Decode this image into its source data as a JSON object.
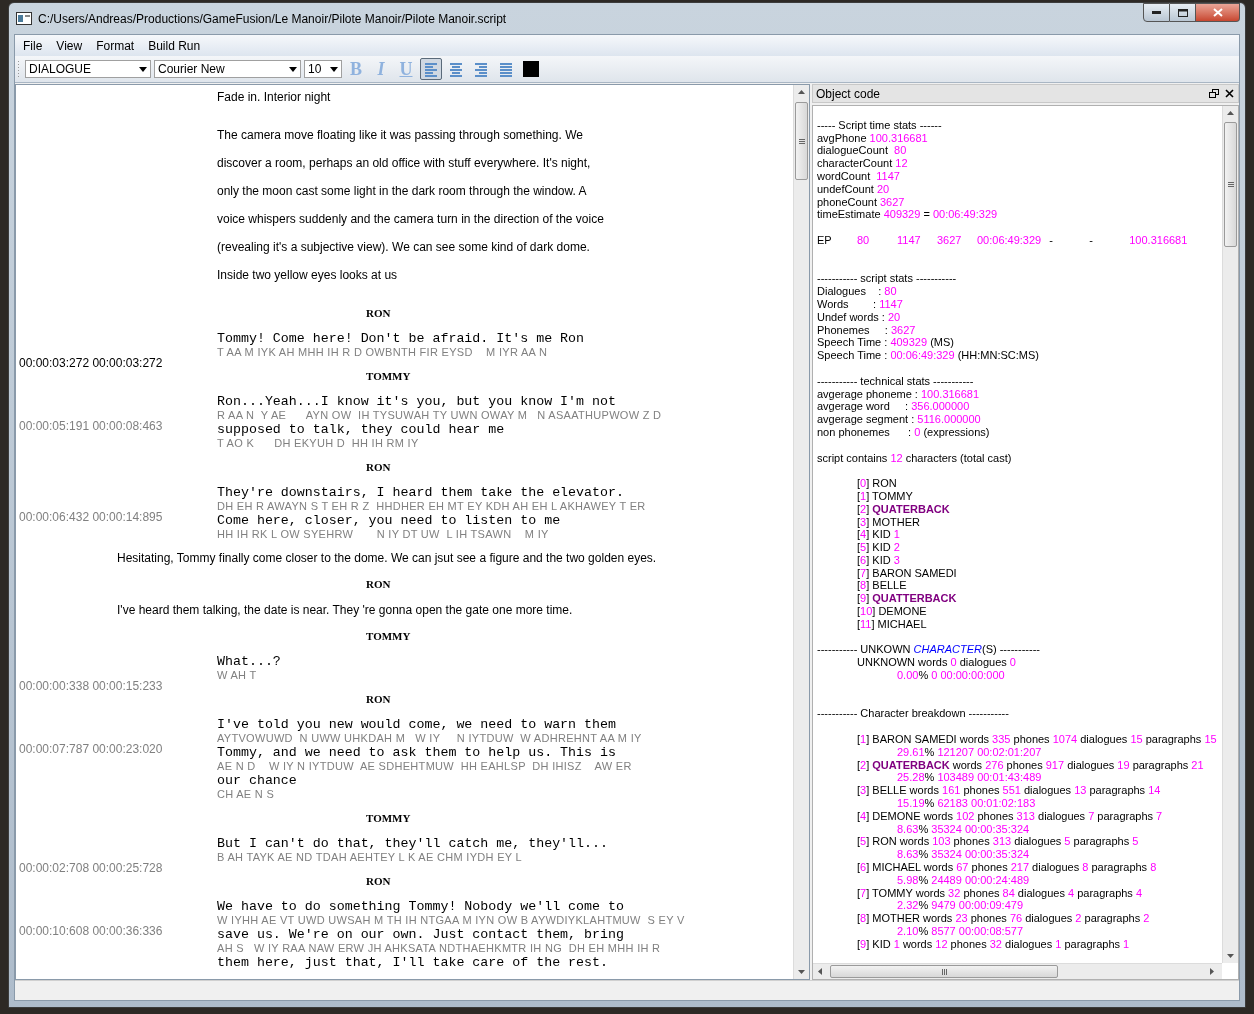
{
  "window": {
    "title": "C:/Users/Andreas/Productions/GameFusion/Le Manoir/Pilote Manoir/Pilote Manoir.script"
  },
  "menu": [
    "File",
    "View",
    "Format",
    "Build Run"
  ],
  "toolbar": {
    "style": "DIALOGUE",
    "font": "Courier New",
    "size": "10",
    "format_buttons": [
      {
        "label": "B",
        "kind": "bold"
      },
      {
        "label": "I",
        "kind": "italic"
      },
      {
        "label": "U",
        "kind": "underline"
      }
    ],
    "align_buttons": [
      {
        "kind": "left",
        "selected": true
      },
      {
        "kind": "center",
        "selected": false
      },
      {
        "kind": "right",
        "selected": false
      },
      {
        "kind": "justify",
        "selected": false
      }
    ]
  },
  "script": [
    {
      "kind": "action",
      "lines": [
        "Fade in. Interior night"
      ]
    },
    {
      "kind": "action",
      "lines": [
        "The camera move floating like it was passing through something. We",
        "discover a room, perhaps an old office with stuff everywhere. It's night,",
        "only the moon cast some light in the dark room through the window. A",
        "voice whispers suddenly and the camera turn in the direction of the voice",
        "(revealing it's a subjective view). We can see some kind of dark dome.",
        "Inside two yellow eyes looks at us"
      ]
    },
    {
      "kind": "character",
      "name": "RON"
    },
    {
      "kind": "dialogue",
      "timecode": "00:00:03:272 00:00:03:272",
      "current": true,
      "lines": [
        {
          "text": "Tommy! Come here! Don't be afraid. It's me Ron",
          "phonemes": "T AA M IYK AH MHH IH R D OWBNTH FIR EYSD    M IYR AA N"
        }
      ]
    },
    {
      "kind": "character",
      "name": "TOMMY"
    },
    {
      "kind": "dialogue",
      "timecode": "00:00:05:191 00:00:08:463",
      "current": false,
      "lines": [
        {
          "text": "Ron...Yeah...I know it's you, but you know I'm not",
          "phonemes": "R AA N  Y AE      AYN OW  IH TYSUWAH TY UWN OWAY M   N ASAATHUPWOW Z D"
        },
        {
          "text": "supposed to talk, they could hear me",
          "phonemes": "T AO K      DH EKYUH D  HH IH RM IY"
        }
      ]
    },
    {
      "kind": "character",
      "name": "RON"
    },
    {
      "kind": "dialogue",
      "timecode": "00:00:06:432 00:00:14:895",
      "current": false,
      "lines": [
        {
          "text": "They're downstairs, I heard them take the elevator.",
          "phonemes": "DH EH R AWAYN S T EH R Z  HHDHER EH MT EY KDH AH EH L AKHAWEY T ER"
        },
        {
          "text": "Come here, closer, you need to listen to me",
          "phonemes": "HH IH RK L OW SYEHRW       N IY DT UW  L IH TSAWN    M IY"
        }
      ]
    },
    {
      "kind": "scene",
      "lines": [
        "Hesitating, Tommy finally come closer to the dome. We can jsut see a figure and the two golden eyes."
      ]
    },
    {
      "kind": "character",
      "name": "RON"
    },
    {
      "kind": "scene",
      "lines": [
        "I've heard them talking, the date is near. They 're gonna open the gate one more time."
      ]
    },
    {
      "kind": "character",
      "name": "TOMMY"
    },
    {
      "kind": "dialogue",
      "timecode": "00:00:00:338 00:00:15:233",
      "current": false,
      "lines": [
        {
          "text": "What...?",
          "phonemes": "W AH T"
        }
      ]
    },
    {
      "kind": "character",
      "name": "RON"
    },
    {
      "kind": "dialogue",
      "timecode": "00:00:07:787 00:00:23:020",
      "current": false,
      "lines": [
        {
          "text": "I've told you new would come, we need to warn them",
          "phonemes": "AYTVOWUWD  N UWW UHKDAH M   W IY     N IYTDUW  W ADHREHNT AA M IY"
        },
        {
          "text": "Tommy, and we need to ask them to help us. This is",
          "phonemes": "AE N D    W IY N IYTDUW  AE SDHEHTMUW  HH EAHLSP  DH IHISZ    AW ER"
        },
        {
          "text": "our chance",
          "phonemes": "CH AE N S"
        }
      ]
    },
    {
      "kind": "character",
      "name": "TOMMY"
    },
    {
      "kind": "dialogue",
      "timecode": "00:00:02:708 00:00:25:728",
      "current": false,
      "lines": [
        {
          "text": "But I can't do that, they'll catch me, they'll...",
          "phonemes": "B AH TAYK AE ND TDAH AEHTEY L K AE CHM IYDH EY L"
        }
      ]
    },
    {
      "kind": "character",
      "name": "RON"
    },
    {
      "kind": "dialogue",
      "timecode": "00:00:10:608 00:00:36:336",
      "current": false,
      "lines": [
        {
          "text": "We have to do something Tommy! Nobody we'll come to",
          "phonemes": "W IYHH AE VT UWD UWSAH M TH IH NTGAA M IYN OW B AYWDIYKLAHTMUW  S EY V"
        },
        {
          "text": "save us. We're on our own. Just contact them, bring",
          "phonemes": "AH S   W IY RAA NAW ERW JH AHKSATA NDTHAEHKMTR IH NG  DH EH MHH IH R"
        },
        {
          "text": "them here, just that, I'll take care of the rest."
        }
      ]
    }
  ],
  "dock": {
    "title": "Object code",
    "lines": [
      {
        "kind": "blank"
      },
      {
        "kind": "text",
        "parts": [
          {
            "text": "----- Script time stats ------",
            "kind": "label"
          }
        ]
      },
      {
        "kind": "text",
        "parts": [
          {
            "text": "avgPhone ",
            "kind": "label"
          },
          {
            "text": "100.316681",
            "kind": "value"
          }
        ]
      },
      {
        "kind": "text",
        "parts": [
          {
            "text": "dialogueCount  ",
            "kind": "label"
          },
          {
            "text": "80",
            "kind": "value"
          }
        ]
      },
      {
        "kind": "text",
        "parts": [
          {
            "text": "characterCount ",
            "kind": "label"
          },
          {
            "text": "12",
            "kind": "value"
          }
        ]
      },
      {
        "kind": "text",
        "parts": [
          {
            "text": "wordCount  ",
            "kind": "label"
          },
          {
            "text": "1147",
            "kind": "value"
          }
        ]
      },
      {
        "kind": "text",
        "parts": [
          {
            "text": "undefCount ",
            "kind": "label"
          },
          {
            "text": "20",
            "kind": "value"
          }
        ]
      },
      {
        "kind": "text",
        "parts": [
          {
            "text": "phoneCount ",
            "kind": "label"
          },
          {
            "text": "3627",
            "kind": "value"
          }
        ]
      },
      {
        "kind": "text",
        "parts": [
          {
            "text": "timeEstimate ",
            "kind": "label"
          },
          {
            "text": "409329",
            "kind": "value"
          },
          {
            "text": " = ",
            "kind": "label"
          },
          {
            "text": "00:06:49:329",
            "kind": "value"
          }
        ]
      },
      {
        "kind": "blank"
      },
      {
        "kind": "row",
        "parts": [
          {
            "text": "EP",
            "kind": "label"
          },
          {
            "text": "80",
            "kind": "value"
          },
          {
            "text": "1147",
            "kind": "value"
          },
          {
            "text": "3627",
            "kind": "value"
          },
          {
            "text": "00:06:49:329",
            "kind": "value"
          },
          {
            "text": "-",
            "kind": "label"
          },
          {
            "text": "-",
            "kind": "label"
          },
          {
            "text": "100.316681",
            "kind": "value"
          }
        ]
      },
      {
        "kind": "blank"
      },
      {
        "kind": "blank"
      },
      {
        "kind": "text",
        "parts": [
          {
            "text": "----------- script stats -----------",
            "kind": "label"
          }
        ]
      },
      {
        "kind": "text",
        "parts": [
          {
            "text": "Dialogues    : ",
            "kind": "label"
          },
          {
            "text": "80",
            "kind": "value"
          }
        ]
      },
      {
        "kind": "text",
        "parts": [
          {
            "text": "Words        : ",
            "kind": "label"
          },
          {
            "text": "1147",
            "kind": "value"
          }
        ]
      },
      {
        "kind": "text",
        "parts": [
          {
            "text": "Undef words : ",
            "kind": "label"
          },
          {
            "text": "20",
            "kind": "value"
          }
        ]
      },
      {
        "kind": "text",
        "parts": [
          {
            "text": "Phonemes     : ",
            "kind": "label"
          },
          {
            "text": "3627",
            "kind": "value"
          }
        ]
      },
      {
        "kind": "text",
        "parts": [
          {
            "text": "Speech Time : ",
            "kind": "label"
          },
          {
            "text": "409329",
            "kind": "value"
          },
          {
            "text": " (MS)",
            "kind": "label"
          }
        ]
      },
      {
        "kind": "text",
        "parts": [
          {
            "text": "Speech Time : ",
            "kind": "label"
          },
          {
            "text": "00:06:49:329",
            "kind": "value"
          },
          {
            "text": " (HH:MN:SC:MS)",
            "kind": "label"
          }
        ]
      },
      {
        "kind": "blank"
      },
      {
        "kind": "text",
        "parts": [
          {
            "text": "----------- technical stats -----------",
            "kind": "label"
          }
        ]
      },
      {
        "kind": "text",
        "parts": [
          {
            "text": "avgerage phoneme : ",
            "kind": "label"
          },
          {
            "text": "100.316681",
            "kind": "value"
          }
        ]
      },
      {
        "kind": "text",
        "parts": [
          {
            "text": "avgerage word     : ",
            "kind": "label"
          },
          {
            "text": "356.000000",
            "kind": "value"
          }
        ]
      },
      {
        "kind": "text",
        "parts": [
          {
            "text": "avgerage segment : ",
            "kind": "label"
          },
          {
            "text": "5116.000000",
            "kind": "value"
          }
        ]
      },
      {
        "kind": "text",
        "parts": [
          {
            "text": "non phonemes      : ",
            "kind": "label"
          },
          {
            "text": "0",
            "kind": "value"
          },
          {
            "text": " (expressions)",
            "kind": "label"
          }
        ]
      },
      {
        "kind": "blank"
      },
      {
        "kind": "text",
        "parts": [
          {
            "text": "script contains ",
            "kind": "label"
          },
          {
            "text": "12",
            "kind": "value"
          },
          {
            "text": " characters (total cast)",
            "kind": "label"
          }
        ]
      },
      {
        "kind": "blank"
      },
      {
        "kind": "item",
        "parts": [
          {
            "text": "[",
            "kind": "label"
          },
          {
            "text": "0",
            "kind": "value"
          },
          {
            "text": "] RON",
            "kind": "label"
          }
        ]
      },
      {
        "kind": "item",
        "parts": [
          {
            "text": "[",
            "kind": "label"
          },
          {
            "text": "1",
            "kind": "value"
          },
          {
            "text": "] TOMMY",
            "kind": "label"
          }
        ]
      },
      {
        "kind": "item",
        "parts": [
          {
            "text": "[",
            "kind": "label"
          },
          {
            "text": "2",
            "kind": "value"
          },
          {
            "text": "] ",
            "kind": "label"
          },
          {
            "text": "QUATERBACK",
            "kind": "name"
          }
        ]
      },
      {
        "kind": "item",
        "parts": [
          {
            "text": "[",
            "kind": "label"
          },
          {
            "text": "3",
            "kind": "value"
          },
          {
            "text": "] MOTHER",
            "kind": "label"
          }
        ]
      },
      {
        "kind": "item",
        "parts": [
          {
            "text": "[",
            "kind": "label"
          },
          {
            "text": "4",
            "kind": "value"
          },
          {
            "text": "] KID ",
            "kind": "label"
          },
          {
            "text": "1",
            "kind": "value"
          }
        ]
      },
      {
        "kind": "item",
        "parts": [
          {
            "text": "[",
            "kind": "label"
          },
          {
            "text": "5",
            "kind": "value"
          },
          {
            "text": "] KID ",
            "kind": "label"
          },
          {
            "text": "2",
            "kind": "value"
          }
        ]
      },
      {
        "kind": "item",
        "parts": [
          {
            "text": "[",
            "kind": "label"
          },
          {
            "text": "6",
            "kind": "value"
          },
          {
            "text": "] KID ",
            "kind": "label"
          },
          {
            "text": "3",
            "kind": "value"
          }
        ]
      },
      {
        "kind": "item",
        "parts": [
          {
            "text": "[",
            "kind": "label"
          },
          {
            "text": "7",
            "kind": "value"
          },
          {
            "text": "] BARON SAMEDI",
            "kind": "label"
          }
        ]
      },
      {
        "kind": "item",
        "parts": [
          {
            "text": "[",
            "kind": "label"
          },
          {
            "text": "8",
            "kind": "value"
          },
          {
            "text": "] BELLE",
            "kind": "label"
          }
        ]
      },
      {
        "kind": "item",
        "parts": [
          {
            "text": "[",
            "kind": "label"
          },
          {
            "text": "9",
            "kind": "value"
          },
          {
            "text": "] ",
            "kind": "label"
          },
          {
            "text": "QUATTERBACK",
            "kind": "name"
          }
        ]
      },
      {
        "kind": "item",
        "parts": [
          {
            "text": "[",
            "kind": "label"
          },
          {
            "text": "10",
            "kind": "value"
          },
          {
            "text": "] DEMONE",
            "kind": "label"
          }
        ]
      },
      {
        "kind": "item",
        "parts": [
          {
            "text": "[",
            "kind": "label"
          },
          {
            "text": "11",
            "kind": "value"
          },
          {
            "text": "] MICHAEL",
            "kind": "label"
          }
        ]
      },
      {
        "kind": "blank"
      },
      {
        "kind": "text",
        "parts": [
          {
            "text": "----------- UNKOWN ",
            "kind": "label"
          },
          {
            "text": "CHARACTER",
            "kind": "link"
          },
          {
            "text": "(S) -----------",
            "kind": "label"
          }
        ]
      },
      {
        "kind": "item",
        "parts": [
          {
            "text": "UNKNOWN words ",
            "kind": "label"
          },
          {
            "text": "0",
            "kind": "value"
          },
          {
            "text": " dialogues ",
            "kind": "label"
          },
          {
            "text": "0",
            "kind": "value"
          }
        ]
      },
      {
        "kind": "detail",
        "parts": [
          {
            "text": "0.00",
            "kind": "value"
          },
          {
            "text": "% ",
            "kind": "label"
          },
          {
            "text": "0 00:00:00:000",
            "kind": "value"
          }
        ]
      },
      {
        "kind": "blank"
      },
      {
        "kind": "blank"
      },
      {
        "kind": "text",
        "parts": [
          {
            "text": "----------- Character breakdown -----------",
            "kind": "label"
          }
        ]
      },
      {
        "kind": "blank"
      },
      {
        "kind": "item",
        "parts": [
          {
            "text": "[",
            "kind": "label"
          },
          {
            "text": "1",
            "kind": "value"
          },
          {
            "text": "] BARON SAMEDI words ",
            "kind": "label"
          },
          {
            "text": "335",
            "kind": "value"
          },
          {
            "text": " phones ",
            "kind": "label"
          },
          {
            "text": "1074",
            "kind": "value"
          },
          {
            "text": " dialogues ",
            "kind": "label"
          },
          {
            "text": "15",
            "kind": "value"
          },
          {
            "text": " paragraphs ",
            "kind": "label"
          },
          {
            "text": "15",
            "kind": "value"
          }
        ]
      },
      {
        "kind": "detail",
        "parts": [
          {
            "text": "29.61",
            "kind": "value"
          },
          {
            "text": "% ",
            "kind": "label"
          },
          {
            "text": "121207 00:02:01:207",
            "kind": "value"
          }
        ]
      },
      {
        "kind": "item",
        "parts": [
          {
            "text": "[",
            "kind": "label"
          },
          {
            "text": "2",
            "kind": "value"
          },
          {
            "text": "] ",
            "kind": "label"
          },
          {
            "text": "QUATERBACK",
            "kind": "name"
          },
          {
            "text": " words ",
            "kind": "label"
          },
          {
            "text": "276",
            "kind": "value"
          },
          {
            "text": " phones ",
            "kind": "label"
          },
          {
            "text": "917",
            "kind": "value"
          },
          {
            "text": " dialogues ",
            "kind": "label"
          },
          {
            "text": "19",
            "kind": "value"
          },
          {
            "text": " paragraphs ",
            "kind": "label"
          },
          {
            "text": "21",
            "kind": "value"
          }
        ]
      },
      {
        "kind": "detail",
        "parts": [
          {
            "text": "25.28",
            "kind": "value"
          },
          {
            "text": "% ",
            "kind": "label"
          },
          {
            "text": "103489 00:01:43:489",
            "kind": "value"
          }
        ]
      },
      {
        "kind": "item",
        "parts": [
          {
            "text": "[",
            "kind": "label"
          },
          {
            "text": "3",
            "kind": "value"
          },
          {
            "text": "] BELLE words ",
            "kind": "label"
          },
          {
            "text": "161",
            "kind": "value"
          },
          {
            "text": " phones ",
            "kind": "label"
          },
          {
            "text": "551",
            "kind": "value"
          },
          {
            "text": " dialogues ",
            "kind": "label"
          },
          {
            "text": "13",
            "kind": "value"
          },
          {
            "text": " paragraphs ",
            "kind": "label"
          },
          {
            "text": "14",
            "kind": "value"
          }
        ]
      },
      {
        "kind": "detail",
        "parts": [
          {
            "text": "15.19",
            "kind": "value"
          },
          {
            "text": "% ",
            "kind": "label"
          },
          {
            "text": "62183 00:01:02:183",
            "kind": "value"
          }
        ]
      },
      {
        "kind": "item",
        "parts": [
          {
            "text": "[",
            "kind": "label"
          },
          {
            "text": "4",
            "kind": "value"
          },
          {
            "text": "] DEMONE words ",
            "kind": "label"
          },
          {
            "text": "102",
            "kind": "value"
          },
          {
            "text": " phones ",
            "kind": "label"
          },
          {
            "text": "313",
            "kind": "value"
          },
          {
            "text": " dialogues ",
            "kind": "label"
          },
          {
            "text": "7",
            "kind": "value"
          },
          {
            "text": " paragraphs ",
            "kind": "label"
          },
          {
            "text": "7",
            "kind": "value"
          }
        ]
      },
      {
        "kind": "detail",
        "parts": [
          {
            "text": "8.63",
            "kind": "value"
          },
          {
            "text": "% ",
            "kind": "label"
          },
          {
            "text": "35324 00:00:35:324",
            "kind": "value"
          }
        ]
      },
      {
        "kind": "item",
        "parts": [
          {
            "text": "[",
            "kind": "label"
          },
          {
            "text": "5",
            "kind": "value"
          },
          {
            "text": "] RON words ",
            "kind": "label"
          },
          {
            "text": "103",
            "kind": "value"
          },
          {
            "text": " phones ",
            "kind": "label"
          },
          {
            "text": "313",
            "kind": "value"
          },
          {
            "text": " dialogues ",
            "kind": "label"
          },
          {
            "text": "5",
            "kind": "value"
          },
          {
            "text": " paragraphs ",
            "kind": "label"
          },
          {
            "text": "5",
            "kind": "value"
          }
        ]
      },
      {
        "kind": "detail",
        "parts": [
          {
            "text": "8.63",
            "kind": "value"
          },
          {
            "text": "% ",
            "kind": "label"
          },
          {
            "text": "35324 00:00:35:324",
            "kind": "value"
          }
        ]
      },
      {
        "kind": "item",
        "parts": [
          {
            "text": "[",
            "kind": "label"
          },
          {
            "text": "6",
            "kind": "value"
          },
          {
            "text": "] MICHAEL words ",
            "kind": "label"
          },
          {
            "text": "67",
            "kind": "value"
          },
          {
            "text": " phones ",
            "kind": "label"
          },
          {
            "text": "217",
            "kind": "value"
          },
          {
            "text": " dialogues ",
            "kind": "label"
          },
          {
            "text": "8",
            "kind": "value"
          },
          {
            "text": " paragraphs ",
            "kind": "label"
          },
          {
            "text": "8",
            "kind": "value"
          }
        ]
      },
      {
        "kind": "detail",
        "parts": [
          {
            "text": "5.98",
            "kind": "value"
          },
          {
            "text": "% ",
            "kind": "label"
          },
          {
            "text": "24489 00:00:24:489",
            "kind": "value"
          }
        ]
      },
      {
        "kind": "item",
        "parts": [
          {
            "text": "[",
            "kind": "label"
          },
          {
            "text": "7",
            "kind": "value"
          },
          {
            "text": "] TOMMY words ",
            "kind": "label"
          },
          {
            "text": "32",
            "kind": "value"
          },
          {
            "text": " phones ",
            "kind": "label"
          },
          {
            "text": "84",
            "kind": "value"
          },
          {
            "text": " dialogues ",
            "kind": "label"
          },
          {
            "text": "4",
            "kind": "value"
          },
          {
            "text": " paragraphs ",
            "kind": "label"
          },
          {
            "text": "4",
            "kind": "value"
          }
        ]
      },
      {
        "kind": "detail",
        "parts": [
          {
            "text": "2.32",
            "kind": "value"
          },
          {
            "text": "% ",
            "kind": "label"
          },
          {
            "text": "9479 00:00:09:479",
            "kind": "value"
          }
        ]
      },
      {
        "kind": "item",
        "parts": [
          {
            "text": "[",
            "kind": "label"
          },
          {
            "text": "8",
            "kind": "value"
          },
          {
            "text": "] MOTHER words ",
            "kind": "label"
          },
          {
            "text": "23",
            "kind": "value"
          },
          {
            "text": " phones ",
            "kind": "label"
          },
          {
            "text": "76",
            "kind": "value"
          },
          {
            "text": " dialogues ",
            "kind": "label"
          },
          {
            "text": "2",
            "kind": "value"
          },
          {
            "text": " paragraphs ",
            "kind": "label"
          },
          {
            "text": "2",
            "kind": "value"
          }
        ]
      },
      {
        "kind": "detail",
        "parts": [
          {
            "text": "2.10",
            "kind": "value"
          },
          {
            "text": "% ",
            "kind": "label"
          },
          {
            "text": "8577 00:00:08:577",
            "kind": "value"
          }
        ]
      },
      {
        "kind": "item",
        "parts": [
          {
            "text": "[",
            "kind": "label"
          },
          {
            "text": "9",
            "kind": "value"
          },
          {
            "text": "] KID ",
            "kind": "label"
          },
          {
            "text": "1",
            "kind": "value"
          },
          {
            "text": " words ",
            "kind": "label"
          },
          {
            "text": "12",
            "kind": "value"
          },
          {
            "text": " phones ",
            "kind": "label"
          },
          {
            "text": "32",
            "kind": "value"
          },
          {
            "text": " dialogues ",
            "kind": "label"
          },
          {
            "text": "1",
            "kind": "value"
          },
          {
            "text": " paragraphs ",
            "kind": "label"
          },
          {
            "text": "1",
            "kind": "value"
          }
        ]
      }
    ]
  }
}
